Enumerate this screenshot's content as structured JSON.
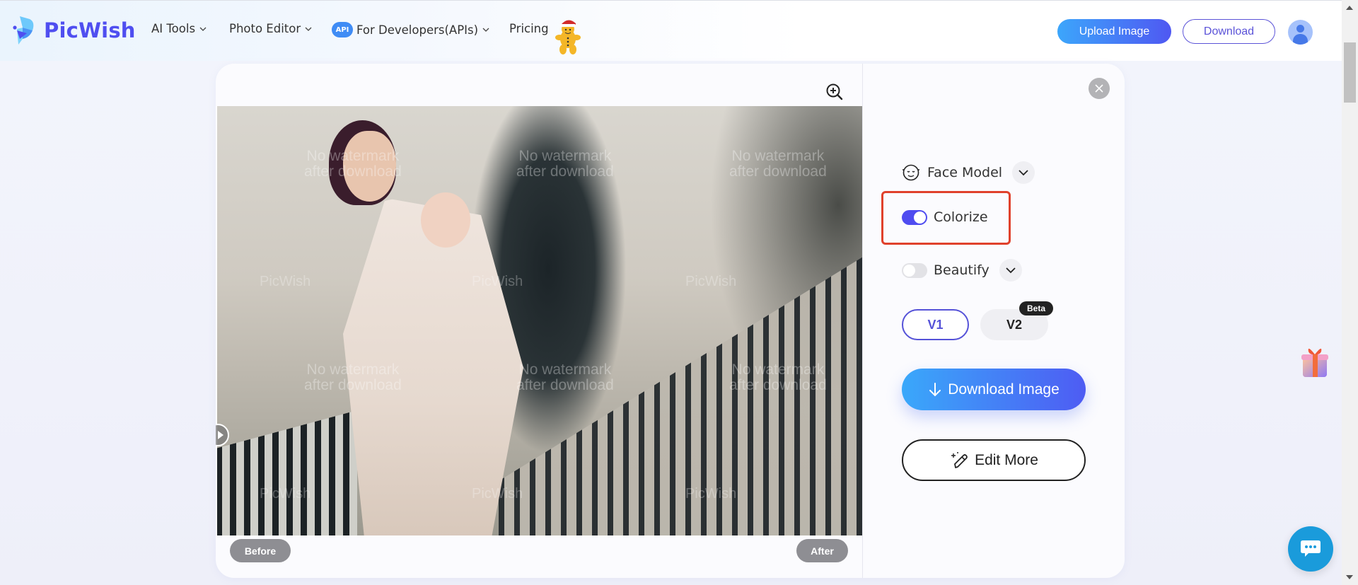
{
  "header": {
    "brand": "PicWish",
    "nav": [
      {
        "label": "AI Tools",
        "has_dropdown": true
      },
      {
        "label": "Photo Editor",
        "has_dropdown": true
      },
      {
        "label": "For Developers(APIs)",
        "has_dropdown": true,
        "badge": "API"
      },
      {
        "label": "Pricing",
        "has_dropdown": false
      }
    ],
    "upload_label": "Upload Image",
    "download_label": "Download",
    "colors": {
      "brand": "#4f4ef0",
      "accent_start": "#3ca6fb",
      "accent_end": "#4f58f2"
    }
  },
  "editor": {
    "watermarks": {
      "no_watermark": "No watermark\nafter download",
      "brand": "PicWish"
    },
    "before_label": "Before",
    "after_label": "After",
    "zoom_icon": "zoom-in-icon",
    "close_icon": "close-icon"
  },
  "panel": {
    "face_model_label": "Face Model",
    "colorize": {
      "label": "Colorize",
      "enabled": true
    },
    "beautify": {
      "label": "Beautify",
      "enabled": false
    },
    "versions": [
      {
        "label": "V1",
        "selected": true
      },
      {
        "label": "V2",
        "selected": false,
        "badge": "Beta"
      }
    ],
    "download_image_label": "Download Image",
    "edit_more_label": "Edit More",
    "highlight_color": "#e0412c"
  },
  "floating": {
    "gift_icon": "gift-icon",
    "chat_icon": "chat-icon"
  }
}
